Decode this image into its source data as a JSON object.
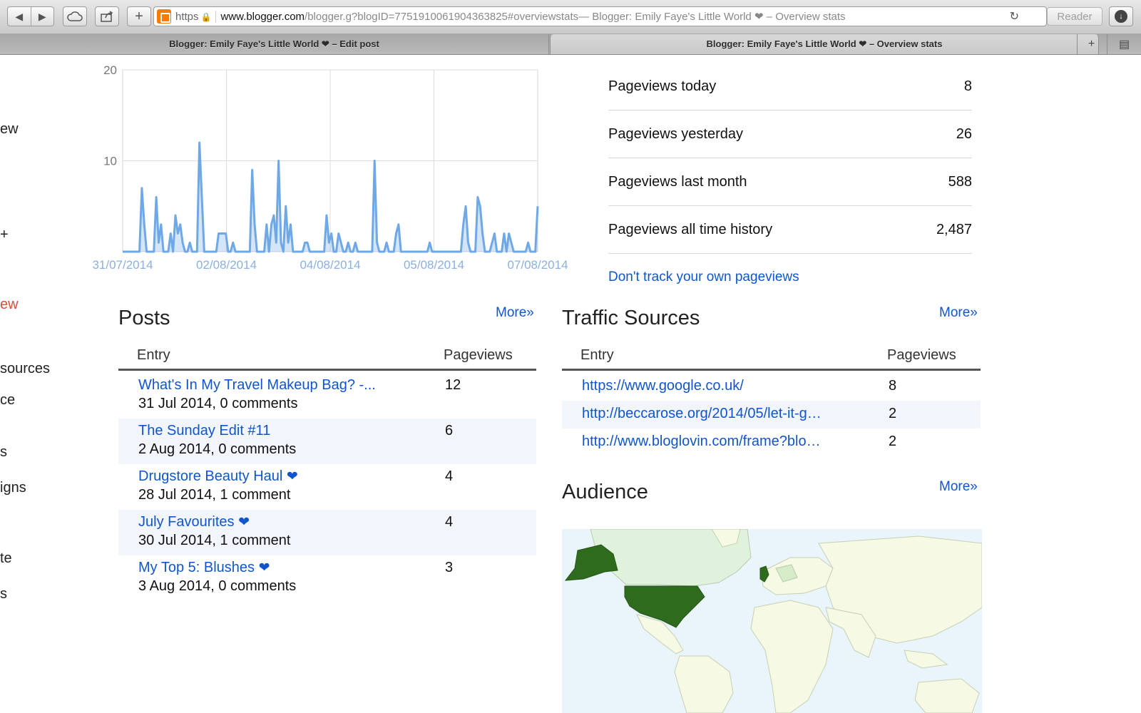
{
  "browser": {
    "url_scheme": "https",
    "url_host": "www.blogger.com",
    "url_path": "/blogger.g?blogID=7751910061904363825#overviewstats",
    "page_title_suffix": " — Blogger: Emily Faye's Little World ❤ – Overview stats",
    "reader_label": "Reader",
    "tabs": [
      {
        "label": "Blogger: Emily Faye's Little World ❤ – Edit post"
      },
      {
        "label": "Blogger: Emily Faye's Little World ❤ – Overview stats"
      }
    ]
  },
  "sidebar_fragments": [
    "ew",
    "+",
    "ew",
    "sources",
    "ce",
    "s",
    "igns",
    "te",
    "s"
  ],
  "chart_data": {
    "type": "area",
    "y_ticks": [
      "20",
      "10"
    ],
    "ylim": [
      0,
      20
    ],
    "x_tick_labels": [
      "31/07/2014",
      "02/08/2014",
      "04/08/2014",
      "05/08/2014",
      "07/08/2014"
    ],
    "values": [
      0,
      0,
      0,
      0,
      0,
      0,
      0,
      0,
      7,
      3,
      0,
      0,
      0,
      0,
      6,
      1,
      3,
      0,
      0,
      0,
      2,
      0,
      4,
      2,
      3,
      1,
      0,
      0,
      1,
      0,
      0,
      0,
      12,
      6,
      0,
      0,
      0,
      0,
      0,
      0,
      2,
      2,
      2,
      2,
      0,
      0,
      1,
      0,
      0,
      0,
      0,
      0,
      0,
      0,
      9,
      3,
      0,
      0,
      0,
      0,
      3,
      0,
      3,
      4,
      1,
      10,
      1,
      0,
      5,
      1,
      3,
      0,
      0,
      0,
      0,
      0,
      1,
      1,
      0,
      0,
      0,
      0,
      0,
      0,
      0,
      4,
      1,
      2,
      0,
      0,
      2,
      1,
      0,
      0,
      1,
      0,
      0,
      1,
      0,
      0,
      0,
      0,
      0,
      0,
      0,
      10,
      1,
      0,
      0,
      0,
      1,
      0,
      0,
      0,
      2,
      3,
      0,
      0,
      0,
      0,
      0,
      0,
      0,
      0,
      0,
      0,
      0,
      0,
      1,
      0,
      0,
      0,
      0,
      0,
      0,
      0,
      0,
      0,
      0,
      0,
      0,
      0,
      3,
      5,
      1,
      0,
      0,
      0,
      6,
      5,
      2,
      0,
      0,
      0,
      1,
      2,
      0,
      0,
      0,
      2,
      0,
      2,
      1,
      0,
      0,
      0,
      0,
      0,
      0,
      1,
      0,
      0,
      0,
      5
    ],
    "grid": true,
    "color": "#6fa8e6"
  },
  "stats": [
    {
      "label": "Pageviews today",
      "value": "8"
    },
    {
      "label": "Pageviews yesterday",
      "value": "26"
    },
    {
      "label": "Pageviews last month",
      "value": "588"
    },
    {
      "label": "Pageviews all time history",
      "value": "2,487"
    }
  ],
  "dont_track_link": "Don't track your own pageviews",
  "posts": {
    "title": "Posts",
    "more": "More»",
    "col_entry": "Entry",
    "col_views": "Pageviews",
    "rows": [
      {
        "title": "What's In My Travel Makeup Bag? -...",
        "heart": "",
        "meta": "31 Jul 2014, 0 comments",
        "views": "12"
      },
      {
        "title": "The Sunday Edit #11",
        "heart": "",
        "meta": "2 Aug 2014, 0 comments",
        "views": "6"
      },
      {
        "title": "Drugstore Beauty Haul",
        "heart": "❤",
        "meta": "28 Jul 2014, 1 comment",
        "views": "4"
      },
      {
        "title": "July Favourites",
        "heart": "❤",
        "meta": "30 Jul 2014, 1 comment",
        "views": "4"
      },
      {
        "title": "My Top 5: Blushes",
        "heart": "❤",
        "meta": "3 Aug 2014, 0 comments",
        "views": "3"
      }
    ]
  },
  "traffic": {
    "title": "Traffic Sources",
    "more": "More»",
    "col_entry": "Entry",
    "col_views": "Pageviews",
    "rows": [
      {
        "url": "https://www.google.co.uk/",
        "views": "8"
      },
      {
        "url": "http://beccarose.org/2014/05/let-it-g…",
        "views": "2"
      },
      {
        "url": "http://www.bloglovin.com/frame?blo…",
        "views": "2"
      }
    ]
  },
  "audience": {
    "title": "Audience",
    "more": "More»"
  }
}
